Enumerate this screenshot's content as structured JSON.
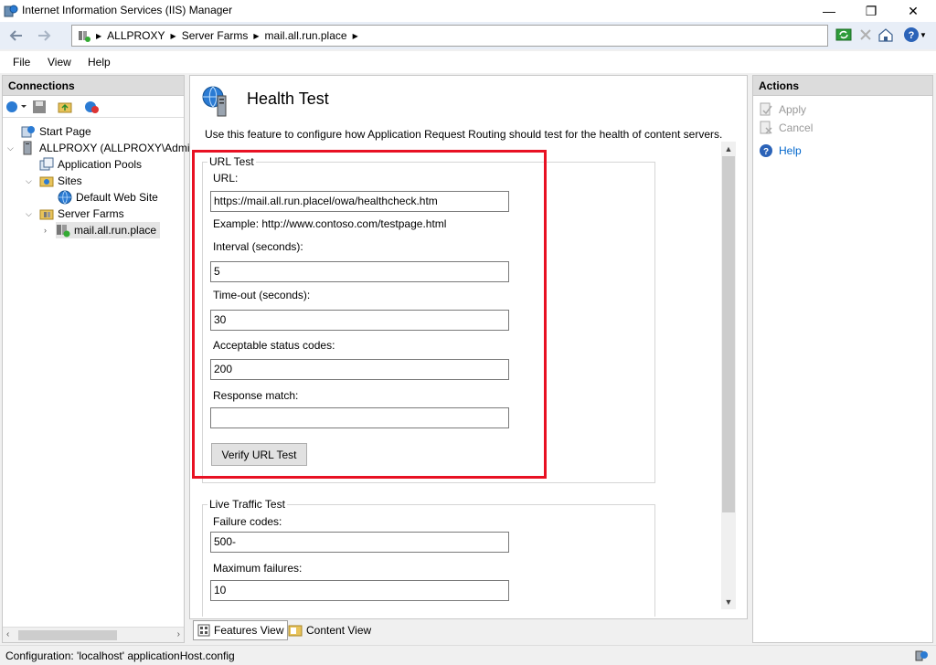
{
  "window": {
    "title": "Internet Information Services (IIS) Manager",
    "minimize": "—",
    "maximize": "❐",
    "close": "✕"
  },
  "address": {
    "breadcrumbs": [
      "ALLPROXY",
      "Server Farms",
      "mail.all.run.place"
    ]
  },
  "menu": {
    "items": [
      "File",
      "View",
      "Help"
    ]
  },
  "connections": {
    "header": "Connections",
    "tree": [
      {
        "label": "Start Page",
        "icon": "start-page-icon"
      },
      {
        "label": "ALLPROXY (ALLPROXY\\Admi",
        "icon": "server-icon"
      },
      {
        "label": "Application Pools",
        "icon": "app-pools-icon"
      },
      {
        "label": "Sites",
        "icon": "sites-folder-icon"
      },
      {
        "label": "Default Web Site",
        "icon": "globe-icon"
      },
      {
        "label": "Server Farms",
        "icon": "server-farms-icon"
      },
      {
        "label": "mail.all.run.place",
        "icon": "server-farm-icon"
      }
    ]
  },
  "feature": {
    "title": "Health Test",
    "description": "Use this feature to configure how Application Request Routing should test for the health of content servers."
  },
  "url_test": {
    "legend": "URL Test",
    "url_label": "URL:",
    "url_value": "https://mail.all.run.placel/owa/healthcheck.htm",
    "example": "Example: http://www.contoso.com/testpage.html",
    "interval_label": "Interval (seconds):",
    "interval_value": "5",
    "timeout_label": "Time-out (seconds):",
    "timeout_value": "30",
    "status_label": "Acceptable status codes:",
    "status_value": "200",
    "match_label": "Response match:",
    "match_value": "",
    "verify_button": "Verify URL Test"
  },
  "live_traffic": {
    "legend": "Live Traffic Test",
    "failure_label": "Failure codes:",
    "failure_value": "500-",
    "max_label": "Maximum failures:",
    "max_value": "10"
  },
  "view_tabs": {
    "features": "Features View",
    "content": "Content View"
  },
  "actions": {
    "header": "Actions",
    "apply": "Apply",
    "cancel": "Cancel",
    "help": "Help"
  },
  "status": {
    "text": "Configuration: 'localhost' applicationHost.config"
  },
  "colors": {
    "highlight": "#e81123",
    "link": "#0066cc"
  }
}
